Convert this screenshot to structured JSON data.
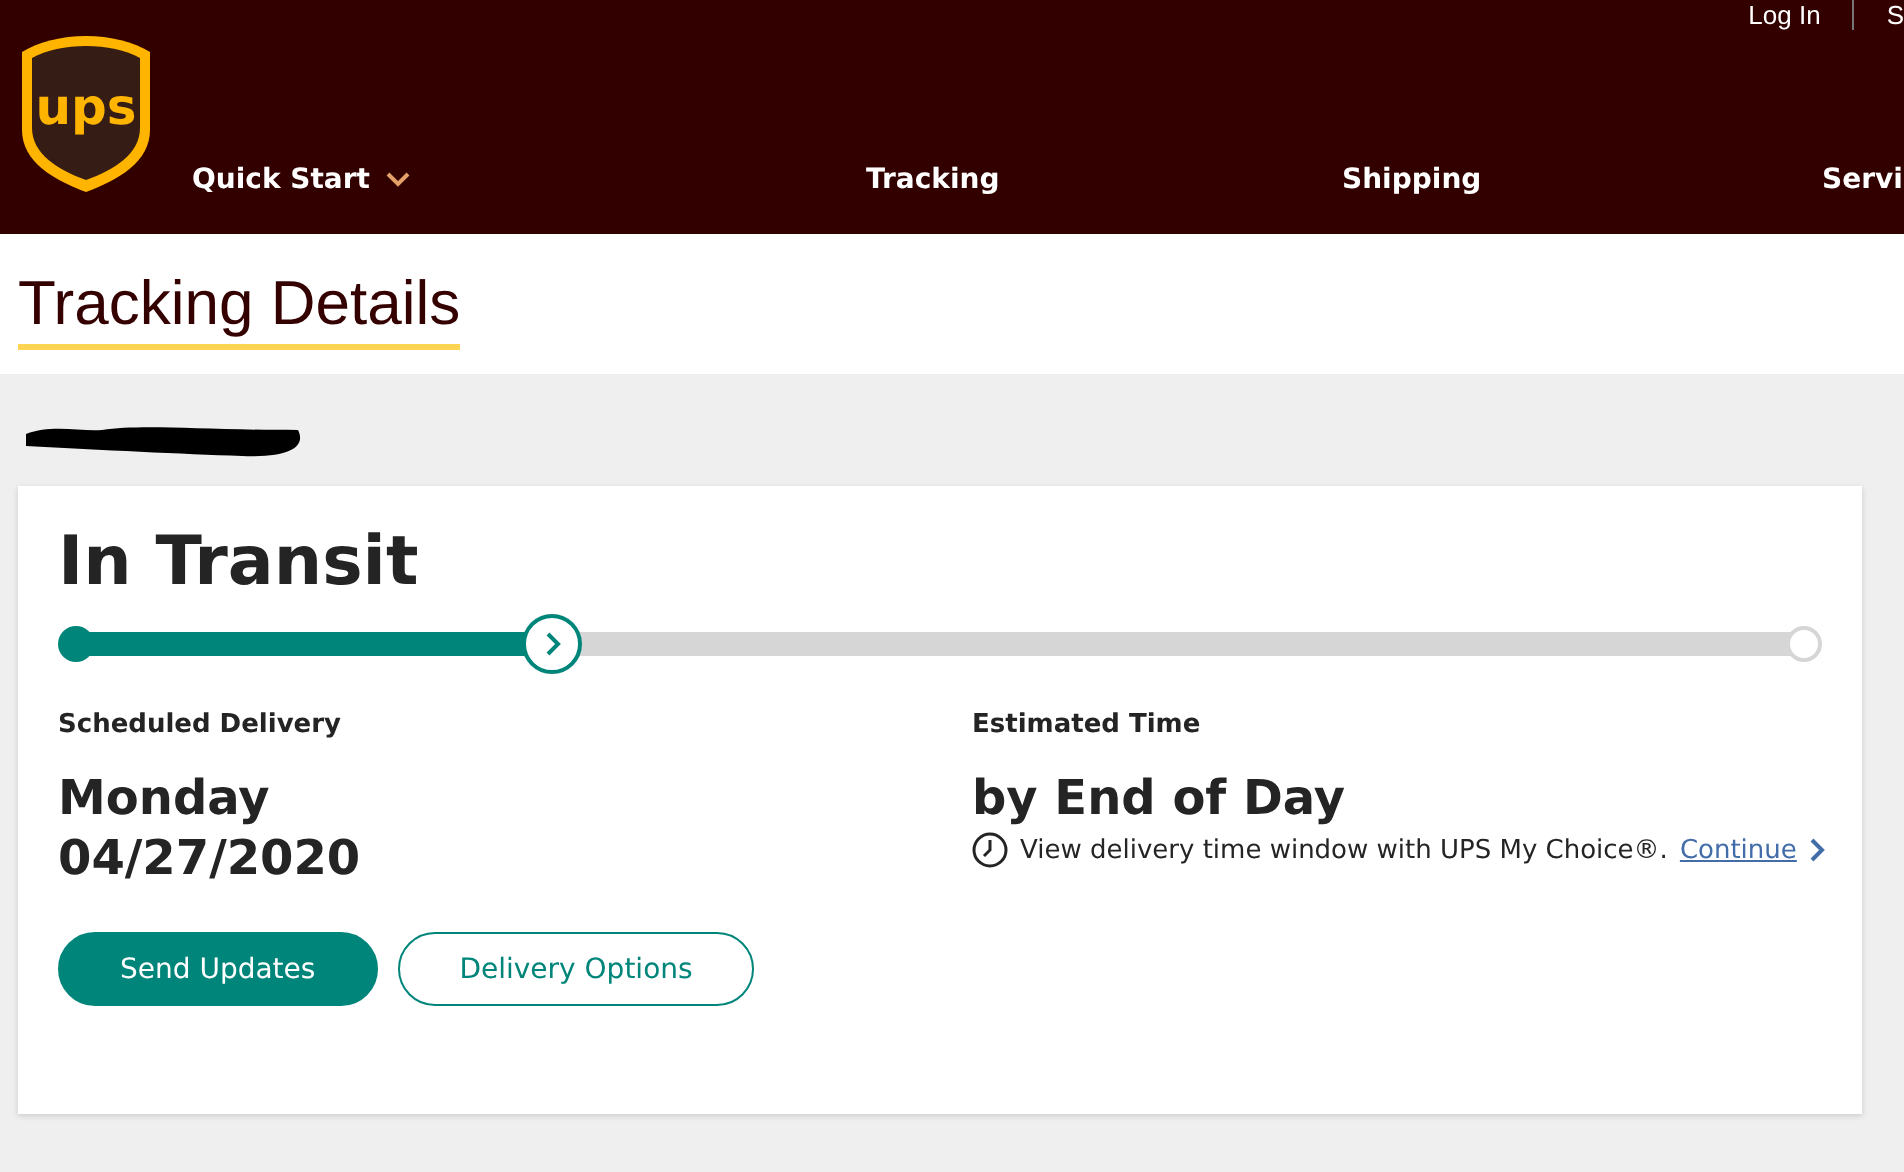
{
  "header": {
    "logo_text": "ups",
    "top_links": [
      "Log In",
      "S"
    ],
    "nav": [
      {
        "label": "Quick Start",
        "has_menu": true
      },
      {
        "label": "Tracking",
        "has_menu": false
      },
      {
        "label": "Shipping",
        "has_menu": false
      },
      {
        "label": "Servi"
      }
    ]
  },
  "page_title": "Tracking Details",
  "shipment": {
    "status": "In Transit",
    "progress": {
      "level": 0.27
    },
    "scheduled": {
      "label": "Scheduled Delivery",
      "lines": [
        "Monday",
        "04/27/2020"
      ]
    },
    "estimated": {
      "label": "Estimated Time",
      "value": "by End of Day",
      "note": "View delivery time window with UPS My Choice®.",
      "link": "Continue"
    },
    "buttons": [
      {
        "label": "Send Updates",
        "kind": "primary"
      },
      {
        "label": "Delivery Options",
        "kind": "secondary"
      }
    ]
  }
}
